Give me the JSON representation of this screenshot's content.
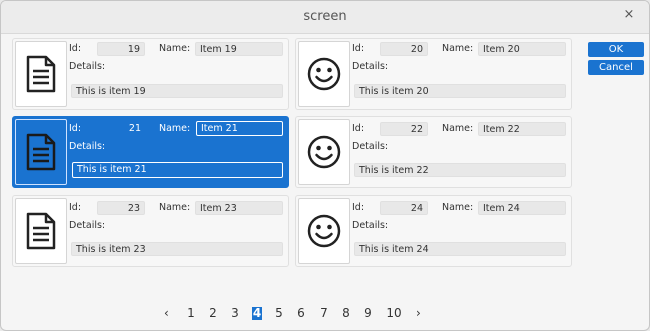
{
  "window": {
    "title": "screen",
    "close_glyph": "×"
  },
  "buttons": {
    "ok": "OK",
    "cancel": "Cancel"
  },
  "labels": {
    "id": "Id:",
    "name": "Name:",
    "details": "Details:"
  },
  "items": [
    {
      "id": "19",
      "name": "Item 19",
      "details": "This is item 19",
      "icon": "document-icon",
      "selected": false
    },
    {
      "id": "20",
      "name": "Item 20",
      "details": "This is item 20",
      "icon": "smiley-icon",
      "selected": false
    },
    {
      "id": "21",
      "name": "Item 21",
      "details": "This is item 21",
      "icon": "document-icon",
      "selected": true
    },
    {
      "id": "22",
      "name": "Item 22",
      "details": "This is item 22",
      "icon": "smiley-icon",
      "selected": false
    },
    {
      "id": "23",
      "name": "Item 23",
      "details": "This is item 23",
      "icon": "document-icon",
      "selected": false
    },
    {
      "id": "24",
      "name": "Item 24",
      "details": "This is item 24",
      "icon": "smiley-icon",
      "selected": false
    }
  ],
  "pager": {
    "prev": "‹",
    "next": "›",
    "pages": [
      "1",
      "2",
      "3",
      "4",
      "5",
      "6",
      "7",
      "8",
      "9",
      "10"
    ],
    "current": "4"
  },
  "colors": {
    "accent": "#1a73d0"
  }
}
